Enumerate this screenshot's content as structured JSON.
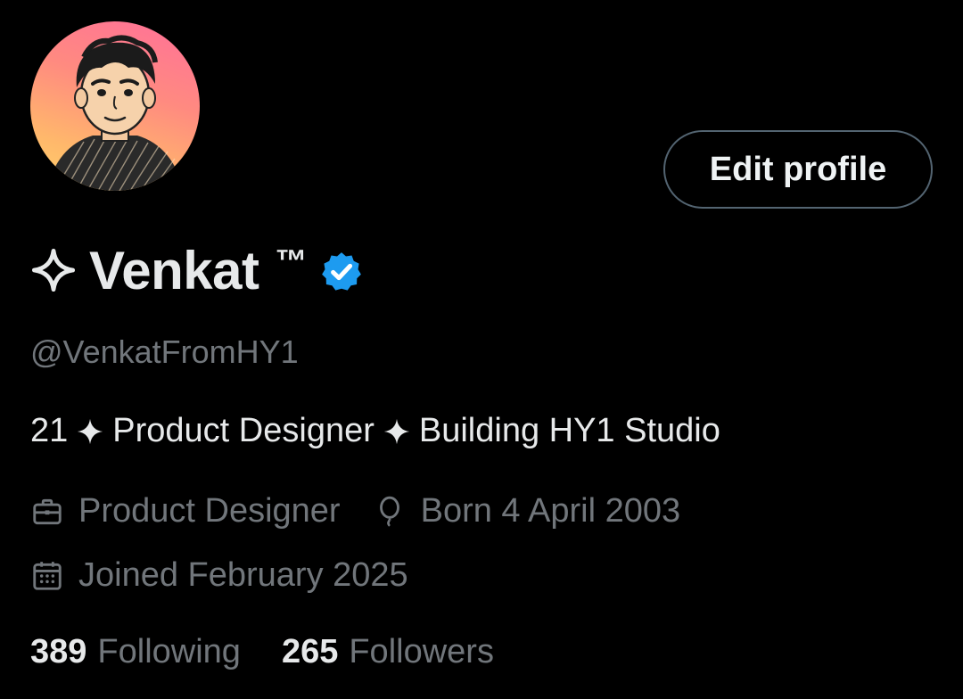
{
  "profile": {
    "display_name": "Venkat",
    "trademark": "™",
    "handle": "@VenkatFromHY1",
    "verified": true,
    "edit_button_label": "Edit profile",
    "bio": {
      "age": "21",
      "role": "Product Designer",
      "project": "Building HY1 Studio"
    },
    "meta": {
      "profession": "Product Designer",
      "birthday": "Born 4 April 2003",
      "joined": "Joined February 2025"
    },
    "stats": {
      "following_count": "389",
      "following_label": "Following",
      "followers_count": "265",
      "followers_label": "Followers"
    }
  },
  "icons": {
    "name_prefix": "sparkle-outline-icon",
    "verified": "verified-badge-icon",
    "profession": "briefcase-icon",
    "birthday": "balloon-icon",
    "joined": "calendar-icon"
  },
  "colors": {
    "background": "#000000",
    "text_primary": "#e7e9ea",
    "text_secondary": "#71767b",
    "border": "#536471",
    "verified_blue": "#1d9bf0"
  }
}
